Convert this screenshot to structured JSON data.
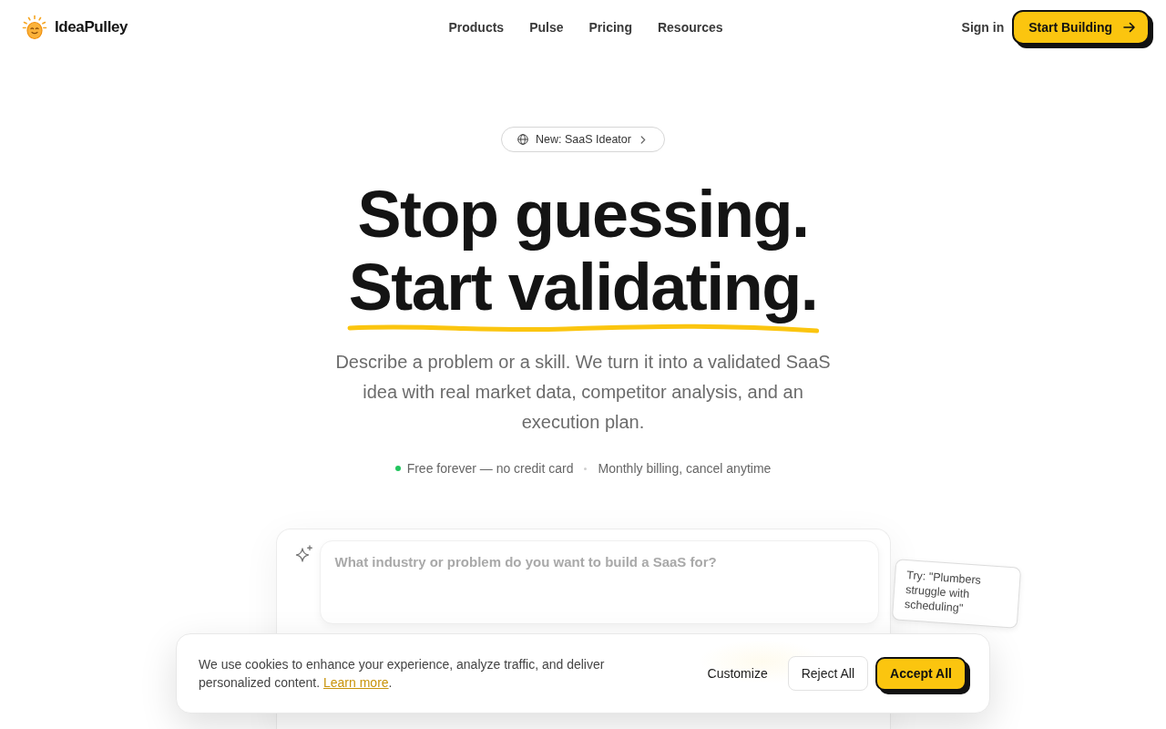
{
  "header": {
    "logo": "IdeaPulley",
    "nav": [
      "Products",
      "Pulse",
      "Pricing",
      "Resources"
    ],
    "sign_in": "Sign in",
    "cta": "Start Building"
  },
  "hero": {
    "badge": "New: SaaS Ideator",
    "headline": [
      {
        "text": "Stop guessing.",
        "underlined": false
      },
      {
        "text": "Start validating.",
        "underlined": true
      }
    ],
    "description": "Describe a problem or a skill. We turn it into a validated SaaS idea with real market data, competitor analysis, and an execution plan.",
    "perks": [
      "Free forever — no credit card",
      "Monthly billing, cancel anytime"
    ]
  },
  "prompt": {
    "placeholder": "What industry or problem do you want to build a SaaS for?",
    "hint": "Try: \"Plumbers struggle with scheduling\""
  },
  "cookie_banner": {
    "text": "We use cookies to enhance your experience, analyze traffic, and deliver personalized content.",
    "link": "Learn more",
    "text_after": ".",
    "buttons": [
      {
        "label": "Customize",
        "kind": "text"
      },
      {
        "label": "Reject All",
        "kind": "outline"
      },
      {
        "label": "Accept All",
        "kind": "primary"
      }
    ]
  }
}
